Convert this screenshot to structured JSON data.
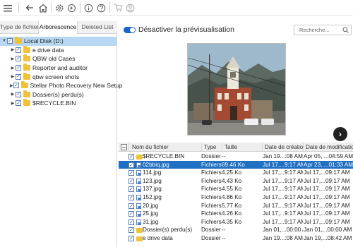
{
  "toolbar": {
    "icons": [
      "menu-icon",
      "back-icon",
      "home-icon",
      "settings-icon",
      "recover-icon",
      "info-icon",
      "help-icon",
      "cart-icon",
      "account-icon"
    ]
  },
  "left_panel": {
    "tabs": [
      {
        "label": "Type de fichier"
      },
      {
        "label": "Arborescence"
      },
      {
        "label": "Deleted List"
      }
    ],
    "tree": [
      {
        "label": "Local Disk (D:)",
        "level": 0,
        "expanded": true,
        "checked": true
      },
      {
        "label": "e drive data",
        "level": 1,
        "checked": true
      },
      {
        "label": "QBW old Cases",
        "level": 1,
        "checked": true
      },
      {
        "label": "Reporter and auditor",
        "level": 1,
        "checked": true
      },
      {
        "label": "qbw screen shots",
        "level": 1,
        "checked": true
      },
      {
        "label": "Stellar Photo Recovery New Setup",
        "level": 1,
        "checked": true
      },
      {
        "label": "Dossier(s) perdu(s)",
        "level": 1,
        "checked": true
      },
      {
        "label": "$RECYCLE.BIN",
        "level": 1,
        "checked": true
      }
    ]
  },
  "preview": {
    "toggle_label": "Désactiver la prévisualisation",
    "toggle_on": true,
    "search_placeholder": "Recherche...",
    "next_arrow": "›"
  },
  "file_table": {
    "columns": [
      "Nom du fichier",
      "Type",
      "Taille",
      "Date de création",
      "Date de modification"
    ],
    "rows": [
      {
        "name": "$RECYCLE.BIN",
        "type": "Dossier",
        "size": "--",
        "created": "Jan 19...:08 AM",
        "modified": "Apr 05, ...04:59 AM",
        "icon": "folder",
        "checked": true,
        "selected": false
      },
      {
        "name": "02bbiq.jpg",
        "type": "Fichiers",
        "size": "69.46 Ko",
        "created": "Jul 17,...9:17 AM",
        "modified": "Apr 23, ...01:33 AM",
        "icon": "image",
        "checked": true,
        "selected": true
      },
      {
        "name": "114.jpg",
        "type": "Fichiers",
        "size": "4.25 Ko",
        "created": "Jul 17,...9:17 AM",
        "modified": "Jul 17,...09:17 AM",
        "icon": "image",
        "checked": true,
        "selected": false
      },
      {
        "name": "123.jpg",
        "type": "Fichiers",
        "size": "4.43 Ko",
        "created": "Jul 17,...9:17 AM",
        "modified": "Jul 17,...09:17 AM",
        "icon": "image",
        "checked": true,
        "selected": false
      },
      {
        "name": "137.jpg",
        "type": "Fichiers",
        "size": "4.55 Ko",
        "created": "Jul 17,...9:17 AM",
        "modified": "Jul 17,...09:17 AM",
        "icon": "image",
        "checked": true,
        "selected": false
      },
      {
        "name": "152.jpg",
        "type": "Fichiers",
        "size": "4.86 Ko",
        "created": "Jul 17,...9:17 AM",
        "modified": "Jul 17,...09:17 AM",
        "icon": "image",
        "checked": true,
        "selected": false
      },
      {
        "name": "20.jpg",
        "type": "Fichiers",
        "size": "5.77 Ko",
        "created": "Jul 17,...9:17 AM",
        "modified": "Jul 17,...09:17 AM",
        "icon": "image",
        "checked": true,
        "selected": false
      },
      {
        "name": "25.jpg",
        "type": "Fichiers",
        "size": "4.26 Ko",
        "created": "Jul 17,...9:17 AM",
        "modified": "Jul 17,...09:17 AM",
        "icon": "image",
        "checked": true,
        "selected": false
      },
      {
        "name": "31.jpg",
        "type": "Fichiers",
        "size": "4.35 Ko",
        "created": "Jul 17,...9:17 AM",
        "modified": "Jul 17,...09:17 AM",
        "icon": "image",
        "checked": true,
        "selected": false
      },
      {
        "name": "Dossier(s) perdu(s)",
        "type": "Dossier",
        "size": "--",
        "created": "Jan 01,...00:00 AM",
        "modified": "Jan 01,...00:00 AM",
        "icon": "folder",
        "checked": true,
        "selected": false
      },
      {
        "name": "e drive data",
        "type": "Dossier",
        "size": "--",
        "created": "Jan 19...:08 AM",
        "modified": "Jan 19,...08:42 AM",
        "icon": "folder",
        "checked": true,
        "selected": false
      }
    ]
  },
  "colors": {
    "accent": "#1f6fc2",
    "tree_selection": "#b7d7f3",
    "folder": "#f0c23a"
  }
}
